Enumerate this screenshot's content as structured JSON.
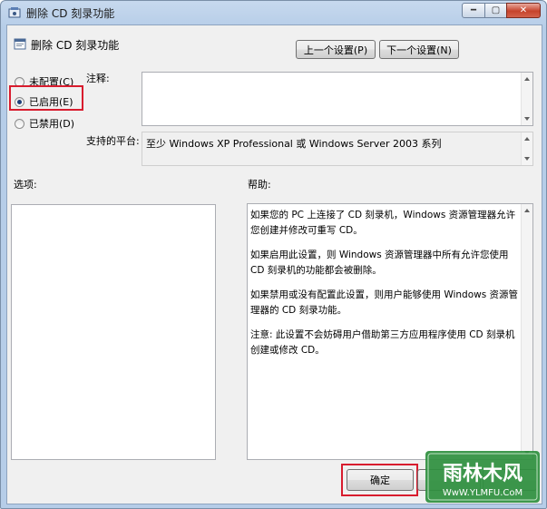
{
  "window": {
    "title": "删除 CD 刻录功能"
  },
  "titlebar_controls": {
    "minimize": "━",
    "maximize": "▢",
    "close": "✕"
  },
  "header": {
    "policy_title": "删除 CD 刻录功能"
  },
  "nav": {
    "prev": "上一个设置(P)",
    "next": "下一个设置(N)"
  },
  "state": {
    "not_configured": "未配置(C)",
    "enabled": "已启用(E)",
    "disabled": "已禁用(D)",
    "selected": "enabled"
  },
  "comment": {
    "label": "注释:",
    "value": ""
  },
  "platform": {
    "label": "支持的平台:",
    "value": "至少 Windows XP Professional 或 Windows Server 2003 系列"
  },
  "options": {
    "label": "选项:"
  },
  "help": {
    "label": "帮助:",
    "paragraphs": [
      "如果您的 PC 上连接了 CD 刻录机，Windows 资源管理器允许您创建并修改可重写 CD。",
      "如果启用此设置，则 Windows 资源管理器中所有允许您使用 CD 刻录机的功能都会被删除。",
      "如果禁用或没有配置此设置，则用户能够使用 Windows 资源管理器的 CD 刻录功能。",
      "注意: 此设置不会妨碍用户借助第三方应用程序使用 CD 刻录机创建或修改 CD。"
    ]
  },
  "footer": {
    "ok": "确定"
  },
  "watermark": {
    "title": "雨林木风",
    "url": "WwW.YLMFU.CoM"
  },
  "colors": {
    "highlight": "#d81c2e",
    "watermark_bg": "#2e8f3e"
  }
}
